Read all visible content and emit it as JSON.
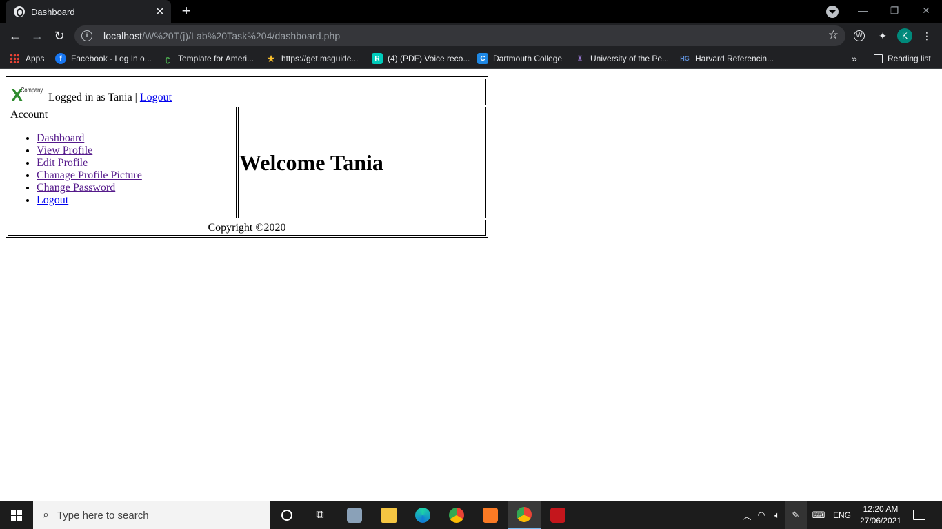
{
  "browser": {
    "tab_title": "Dashboard",
    "url_host": "localhost",
    "url_path": "/W%20T(j)/Lab%20Task%204/dashboard.php",
    "profile_initial": "K",
    "bookmarks": [
      {
        "label": "Apps",
        "icon": "apps-grid-icon"
      },
      {
        "label": "Facebook - Log In o...",
        "icon": "facebook-icon"
      },
      {
        "label": "Template for Ameri...",
        "icon": "leaf-icon"
      },
      {
        "label": "https://get.msguide...",
        "icon": "star-icon"
      },
      {
        "label": "(4) (PDF) Voice reco...",
        "icon": "researchgate-icon"
      },
      {
        "label": "Dartmouth College",
        "icon": "c-icon"
      },
      {
        "label": "University of the Pe...",
        "icon": "university-icon"
      },
      {
        "label": "Harvard Referencin...",
        "icon": "hg-icon"
      }
    ],
    "more_bookmarks": "»",
    "reading_list": "Reading list"
  },
  "page": {
    "logo_letter": "X",
    "logo_text": "Company",
    "logged_in_text": "Logged in as Tania |",
    "header_logout": "Logout",
    "account_label": "Account",
    "menu": [
      "Dashboard",
      "View Profile",
      "Edit Profile",
      "Chanage Profile Picture",
      "Change Password",
      "Logout"
    ],
    "welcome": "Welcome Tania",
    "copyright": "Copyright ©2020"
  },
  "taskbar": {
    "search_placeholder": "Type here to search",
    "language": "ENG",
    "time": "12:20 AM",
    "date": "27/06/2021"
  },
  "colors": {
    "chrome_bg": "#202124",
    "titlebar_bg": "#000000",
    "link_visited": "#551a8b",
    "link": "#0000ee",
    "taskbar_bg": "#1c1c1c"
  }
}
